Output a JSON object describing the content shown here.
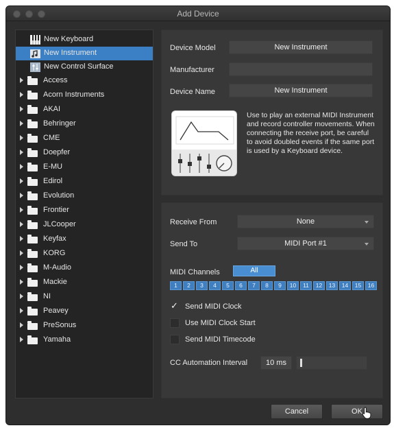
{
  "window": {
    "title": "Add Device"
  },
  "tree": {
    "top_items": [
      {
        "label": "New Keyboard",
        "icon": "keyboard-icon"
      },
      {
        "label": "New Instrument",
        "icon": "instrument-icon",
        "selected": true
      },
      {
        "label": "New Control Surface",
        "icon": "control-surface-icon"
      }
    ],
    "folders": [
      "Access",
      "Acorn Instruments",
      "AKAI",
      "Behringer",
      "CME",
      "Doepfer",
      "E-MU",
      "Edirol",
      "Evolution",
      "Frontier",
      "JLCooper",
      "Keyfax",
      "KORG",
      "M-Audio",
      "Mackie",
      "NI",
      "Peavey",
      "PreSonus",
      "Yamaha"
    ]
  },
  "device": {
    "model_label": "Device Model",
    "model_value": "New Instrument",
    "manufacturer_label": "Manufacturer",
    "manufacturer_value": "",
    "name_label": "Device Name",
    "name_value": "New Instrument",
    "description": "Use to play an external MIDI Instrument and record controller movements. When connecting the receive port, be careful to avoid doubled events if the same port is used by a Keyboard device."
  },
  "ports": {
    "receive_label": "Receive From",
    "receive_value": "None",
    "send_label": "Send To",
    "send_value": "MIDI Port #1"
  },
  "midi": {
    "channels_label": "MIDI Channels",
    "all_label": "All",
    "channels": [
      "1",
      "2",
      "3",
      "4",
      "5",
      "6",
      "7",
      "8",
      "9",
      "10",
      "11",
      "12",
      "13",
      "14",
      "15",
      "16"
    ]
  },
  "options": {
    "send_clock": {
      "label": "Send MIDI Clock",
      "checked": true
    },
    "clock_start": {
      "label": "Use MIDI Clock Start",
      "checked": false
    },
    "timecode": {
      "label": "Send MIDI Timecode",
      "checked": false
    }
  },
  "cc": {
    "label": "CC Automation Interval",
    "value": "10 ms",
    "level": 0.05
  },
  "buttons": {
    "cancel": "Cancel",
    "ok": "OK"
  }
}
